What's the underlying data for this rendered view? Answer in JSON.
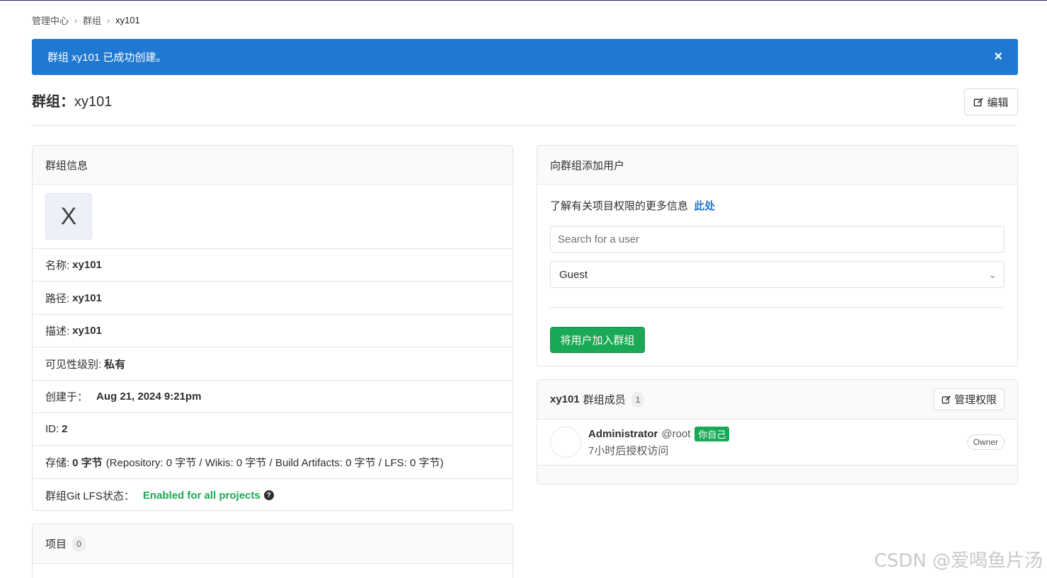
{
  "breadcrumb": [
    "管理中心",
    "群组",
    "xy101"
  ],
  "flash": {
    "message": "群组 xy101 已成功创建。",
    "close": "×"
  },
  "page": {
    "title_prefix": "群组：",
    "title_name": "xy101",
    "edit_label": "编辑"
  },
  "group_info": {
    "header": "群组信息",
    "avatar_letter": "X",
    "name_label": "名称:",
    "name_value": "xy101",
    "path_label": "路径:",
    "path_value": "xy101",
    "desc_label": "描述:",
    "desc_value": "xy101",
    "visibility_label": "可见性级别:",
    "visibility_value": "私有",
    "created_label": "创建于：",
    "created_value": "Aug 21, 2024 9:21pm",
    "id_label": "ID:",
    "id_value": "2",
    "storage_label": "存储:",
    "storage_value": "0 字节",
    "storage_detail": "(Repository: 0 字节 / Wikis: 0 字节 / Build Artifacts: 0 字节 / LFS: 0 字节)",
    "lfs_label": "群组Git LFS状态：",
    "lfs_value": "Enabled for all projects"
  },
  "projects": {
    "header": "项目",
    "count": "0"
  },
  "add_user": {
    "header": "向群组添加用户",
    "info_text": "了解有关项目权限的更多信息",
    "info_link": "此处",
    "search_placeholder": "Search for a user",
    "role_selected": "Guest",
    "submit_label": "将用户加入群组"
  },
  "members": {
    "group_name": "xy101",
    "header_suffix": "群组成员",
    "count": "1",
    "manage_label": "管理权限",
    "list": [
      {
        "name": "Administrator",
        "username": "@root",
        "self_badge": "你自己",
        "subtitle": "7小时后授权访问",
        "role": "Owner"
      }
    ]
  },
  "watermark": "CSDN @爱喝鱼片汤"
}
